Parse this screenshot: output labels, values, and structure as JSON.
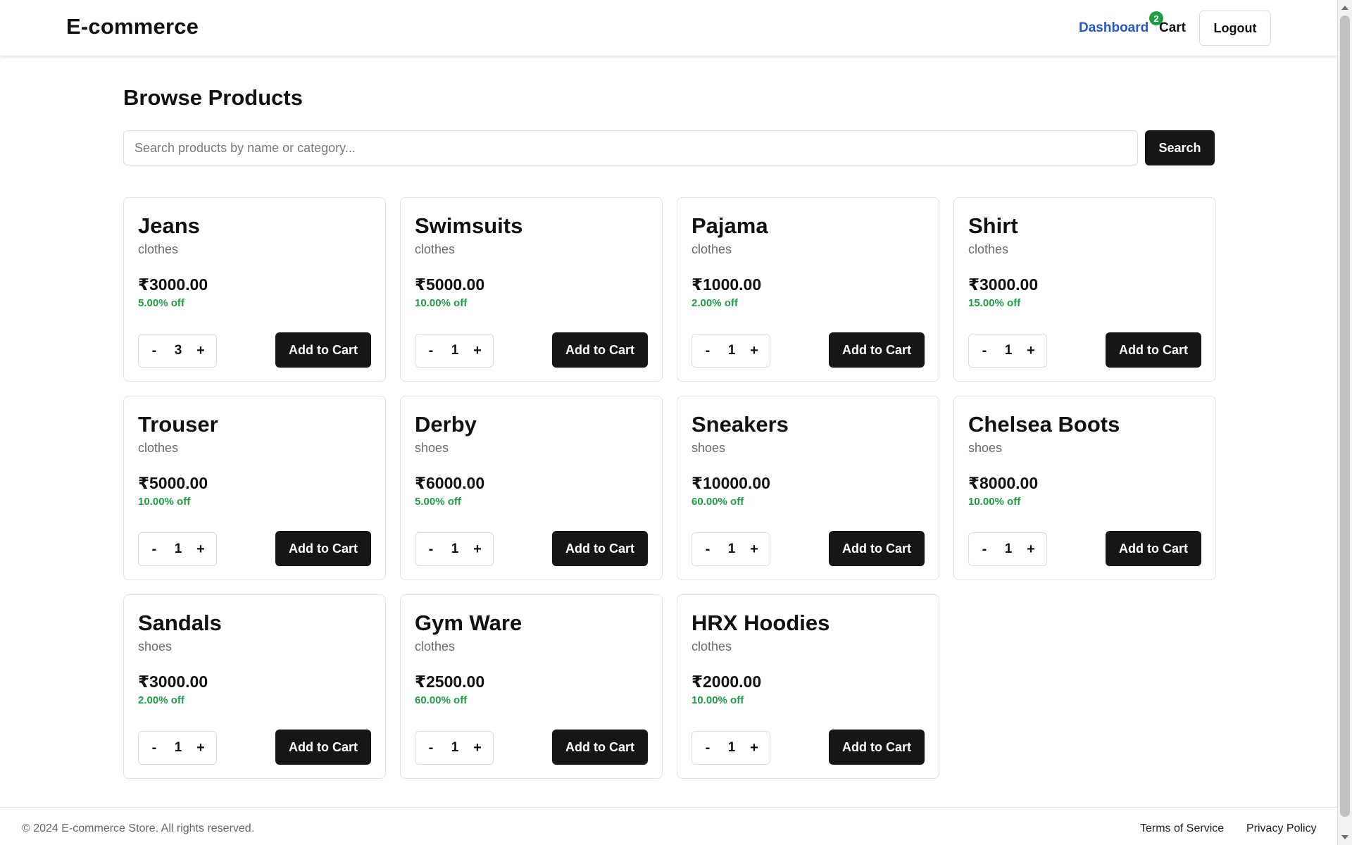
{
  "header": {
    "brand": "E-commerce",
    "nav": {
      "dashboard_label": "Dashboard",
      "cart_label": "Cart",
      "cart_count": "2",
      "logout_label": "Logout"
    }
  },
  "main": {
    "title": "Browse Products",
    "search": {
      "placeholder": "Search products by name or category...",
      "value": "",
      "button_label": "Search"
    },
    "add_label": "Add to Cart",
    "minus_label": "-",
    "plus_label": "+",
    "products": [
      {
        "name": "Jeans",
        "category": "clothes",
        "price": "₹3000.00",
        "discount": "5.00% off",
        "qty": "3"
      },
      {
        "name": "Swimsuits",
        "category": "clothes",
        "price": "₹5000.00",
        "discount": "10.00% off",
        "qty": "1"
      },
      {
        "name": "Pajama",
        "category": "clothes",
        "price": "₹1000.00",
        "discount": "2.00% off",
        "qty": "1"
      },
      {
        "name": "Shirt",
        "category": "clothes",
        "price": "₹3000.00",
        "discount": "15.00% off",
        "qty": "1"
      },
      {
        "name": "Trouser",
        "category": "clothes",
        "price": "₹5000.00",
        "discount": "10.00% off",
        "qty": "1"
      },
      {
        "name": "Derby",
        "category": "shoes",
        "price": "₹6000.00",
        "discount": "5.00% off",
        "qty": "1"
      },
      {
        "name": "Sneakers",
        "category": "shoes",
        "price": "₹10000.00",
        "discount": "60.00% off",
        "qty": "1"
      },
      {
        "name": "Chelsea Boots",
        "category": "shoes",
        "price": "₹8000.00",
        "discount": "10.00% off",
        "qty": "1"
      },
      {
        "name": "Sandals",
        "category": "shoes",
        "price": "₹3000.00",
        "discount": "2.00% off",
        "qty": "1"
      },
      {
        "name": "Gym Ware",
        "category": "clothes",
        "price": "₹2500.00",
        "discount": "60.00% off",
        "qty": "1"
      },
      {
        "name": "HRX Hoodies",
        "category": "clothes",
        "price": "₹2000.00",
        "discount": "10.00% off",
        "qty": "1"
      }
    ]
  },
  "footer": {
    "copyright": "© 2024 E-commerce Store. All rights reserved.",
    "terms_label": "Terms of Service",
    "privacy_label": "Privacy Policy"
  },
  "colors": {
    "accent_link": "#2458c9",
    "primary_button": "#161616",
    "discount_green": "#1f9d45",
    "badge_green": "#1f9d45"
  }
}
